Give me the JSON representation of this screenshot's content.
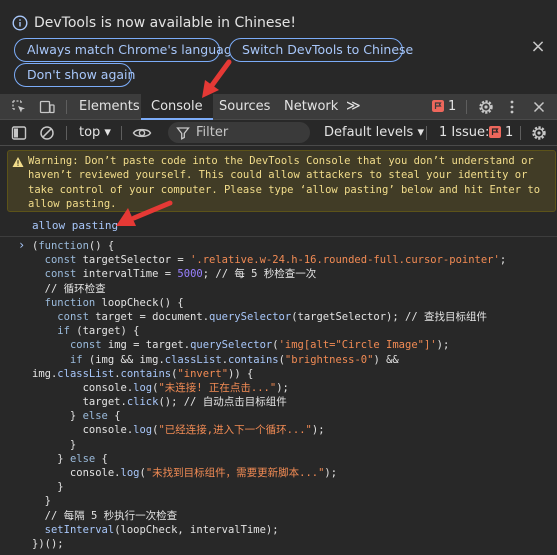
{
  "notice": {
    "title": "DevTools is now available in Chinese!",
    "buttons": {
      "match_language": "Always match Chrome's language",
      "switch_chinese": "Switch DevTools to Chinese",
      "dont_show": "Don't show again"
    },
    "close_icon": "×"
  },
  "tabs": {
    "elements": "Elements",
    "console": "Console",
    "sources": "Sources",
    "network": "Network",
    "more": "≫",
    "issue_count": "1"
  },
  "console_toolbar": {
    "context": "top ▾",
    "filter_placeholder": "Filter",
    "levels": "Default levels ▾",
    "issues_label": "1 Issue:",
    "issues_count": "1"
  },
  "warning": {
    "text": "Warning: Don’t paste code into the DevTools Console that you don’t understand or\nhaven’t reviewed yourself. This could allow attackers to steal your identity or\ntake control of your computer. Please type ‘allow pasting’ below and hit Enter to\nallow pasting."
  },
  "typed_command": "allow pasting",
  "prompt_symbol": "›",
  "code_lines": [
    "(function() {",
    "  const targetSelector = '.relative.w-24.h-16.rounded-full.cursor-pointer';",
    "  const intervalTime = 5000; // 每 5 秒检查一次",
    "  // 循环检查",
    "  function loopCheck() {",
    "    const target = document.querySelector(targetSelector); // 查找目标组件",
    "    if (target) {",
    "      const img = target.querySelector('img[alt=\"Circle Image\"]');",
    "      if (img && img.classList.contains(\"brightness-0\") &&",
    "img.classList.contains(\"invert\")) {",
    "        console.log(\"未连接! 正在点击...\");",
    "        target.click(); // 自动点击目标组件",
    "      } else {",
    "        console.log(\"已经连接,进入下一个循环...\");",
    "      }",
    "    } else {",
    "      console.log(\"未找到目标组件，需要更新脚本...\");",
    "    }",
    "  }",
    "  // 每隔 5 秒执行一次检查",
    "  setInterval(loopCheck, intervalTime);",
    "})();"
  ],
  "colors": {
    "background": "#282828",
    "tabbar": "#3c3c3c",
    "accent": "#7cacf8",
    "warning_bg": "#413c26",
    "warning_text": "#f2dd8b",
    "arrow": "#e53935"
  }
}
